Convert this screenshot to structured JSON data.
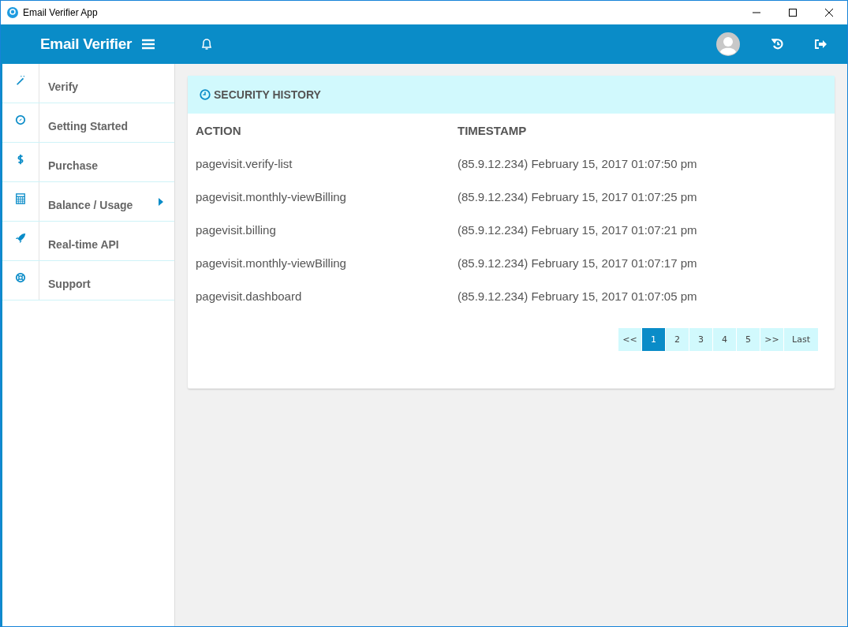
{
  "window": {
    "title": "Email Verifier App"
  },
  "header": {
    "brand": "Email Verifier"
  },
  "sidebar": {
    "items": [
      {
        "label": "Verify",
        "has_submenu": false
      },
      {
        "label": "Getting Started",
        "has_submenu": false
      },
      {
        "label": "Purchase",
        "has_submenu": false
      },
      {
        "label": "Balance / Usage",
        "has_submenu": true
      },
      {
        "label": "Real-time API",
        "has_submenu": false
      },
      {
        "label": "Support",
        "has_submenu": false
      }
    ]
  },
  "panel": {
    "title": "SECURITY HISTORY",
    "table": {
      "columns": [
        "ACTION",
        "TIMESTAMP"
      ],
      "rows": [
        [
          "pagevisit.verify-list",
          "(85.9.12.234) February 15, 2017 01:07:50 pm"
        ],
        [
          "pagevisit.monthly-viewBilling",
          "(85.9.12.234) February 15, 2017 01:07:25 pm"
        ],
        [
          "pagevisit.billing",
          "(85.9.12.234) February 15, 2017 01:07:21 pm"
        ],
        [
          "pagevisit.monthly-viewBilling",
          "(85.9.12.234) February 15, 2017 01:07:17 pm"
        ],
        [
          "pagevisit.dashboard",
          "(85.9.12.234) February 15, 2017 01:07:05 pm"
        ]
      ]
    },
    "pagination": [
      {
        "label": "<<",
        "selected": false
      },
      {
        "label": "1",
        "selected": true
      },
      {
        "label": "2",
        "selected": false
      },
      {
        "label": "3",
        "selected": false
      },
      {
        "label": "4",
        "selected": false
      },
      {
        "label": "5",
        "selected": false
      },
      {
        "label": ">>",
        "selected": false
      },
      {
        "label": "Last",
        "selected": false
      }
    ]
  }
}
